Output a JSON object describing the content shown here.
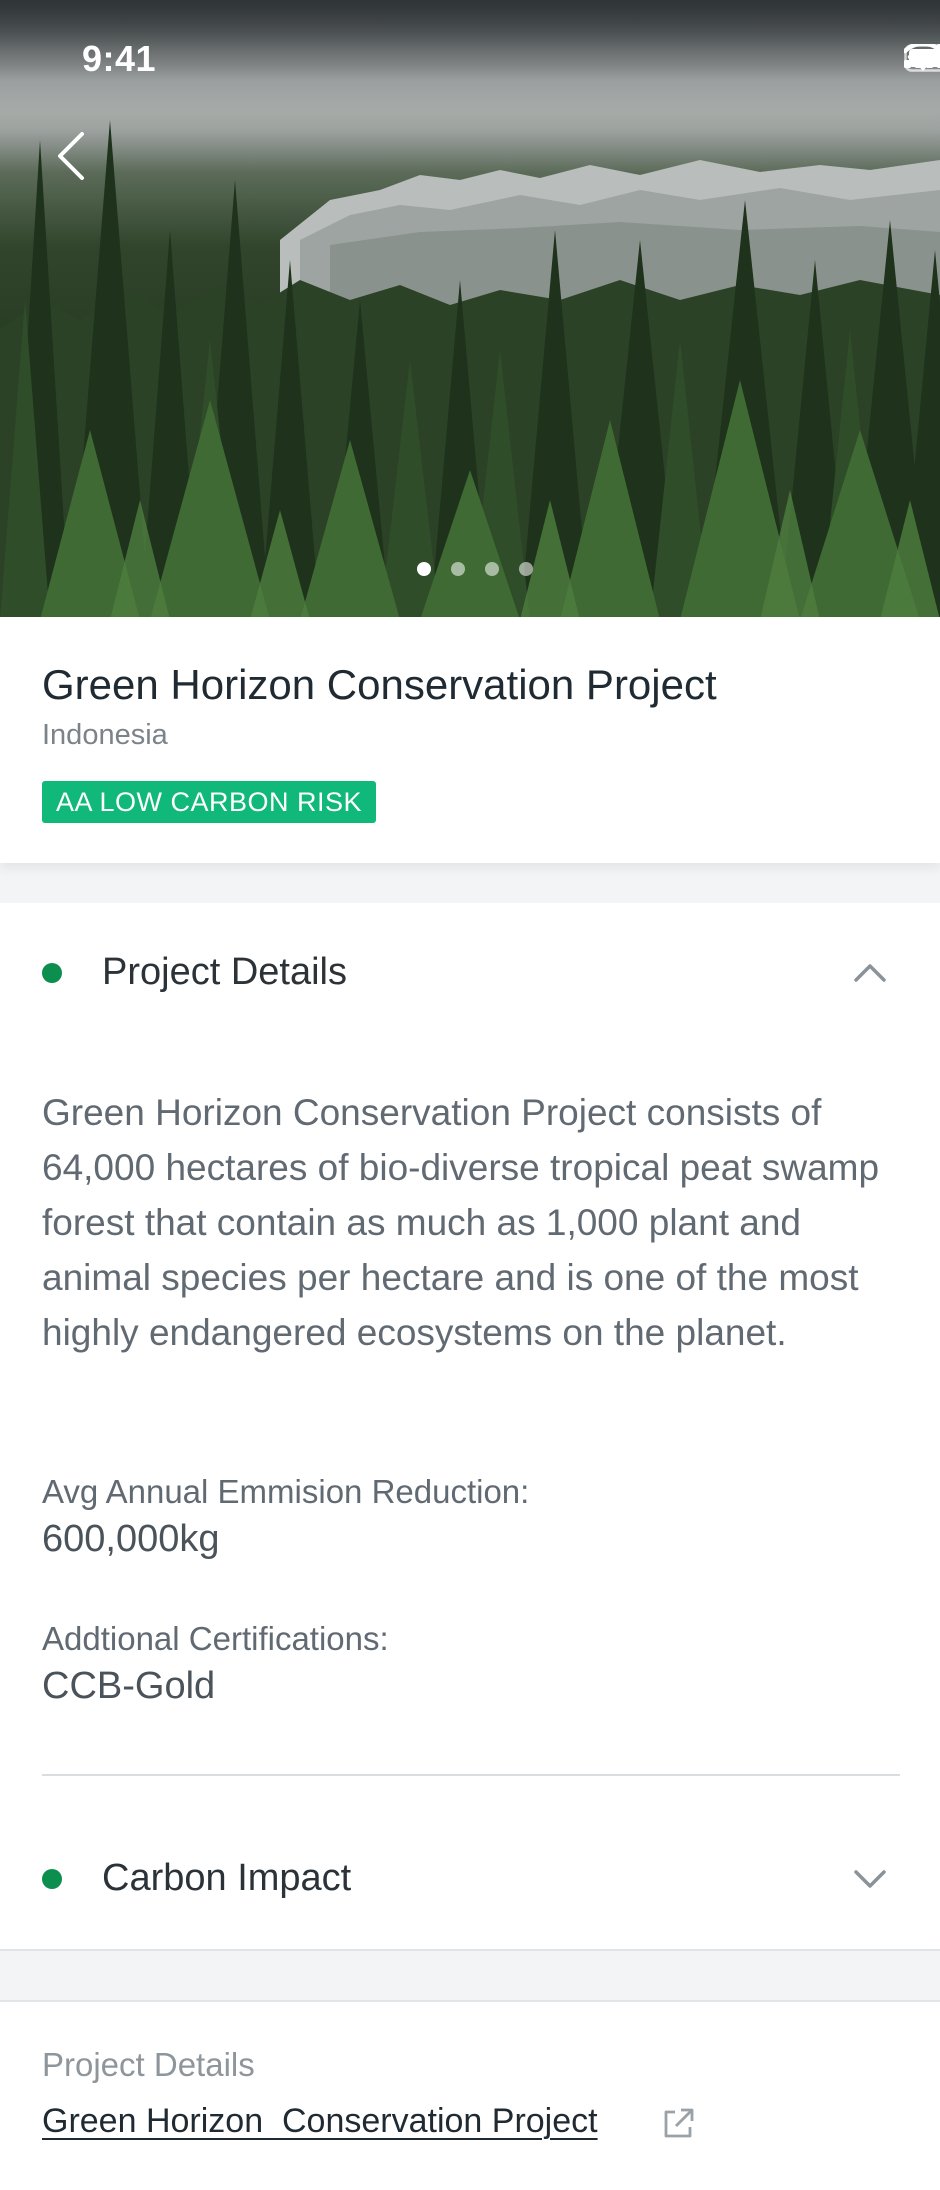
{
  "status_bar": {
    "time": "9:41"
  },
  "hero": {
    "carousel_count": 4,
    "carousel_active_index": 0
  },
  "project": {
    "title": "Green Horizon Conservation Project",
    "location": "Indonesia",
    "risk_badge": "AA LOW CARBON RISK"
  },
  "details": {
    "section_title": "Project Details",
    "description": "Green Horizon Conservation Project consists of 64,000 hectares of bio-diverse tropical peat swamp forest that contain as much as 1,000 plant and animal species per hectare and is one of the most highly endangered ecosystems on the planet.",
    "emission_label": "Avg Annual Emmision Reduction:",
    "emission_value": "600,000kg",
    "certifications_label": "Addtional Certifications:",
    "certifications_value": "CCB-Gold",
    "expanded": true
  },
  "carbon_impact": {
    "section_title": "Carbon Impact",
    "expanded": false
  },
  "footer": {
    "label": "Project Details",
    "link_text": "Green Horizon  Conservation Project"
  },
  "colors": {
    "accent_green": "#0c8f4e",
    "badge_green": "#10b97a"
  },
  "icons": {
    "back": "chevron-left-icon",
    "collapse": "chevron-up-icon",
    "expand": "chevron-down-icon",
    "external": "external-link-icon"
  }
}
